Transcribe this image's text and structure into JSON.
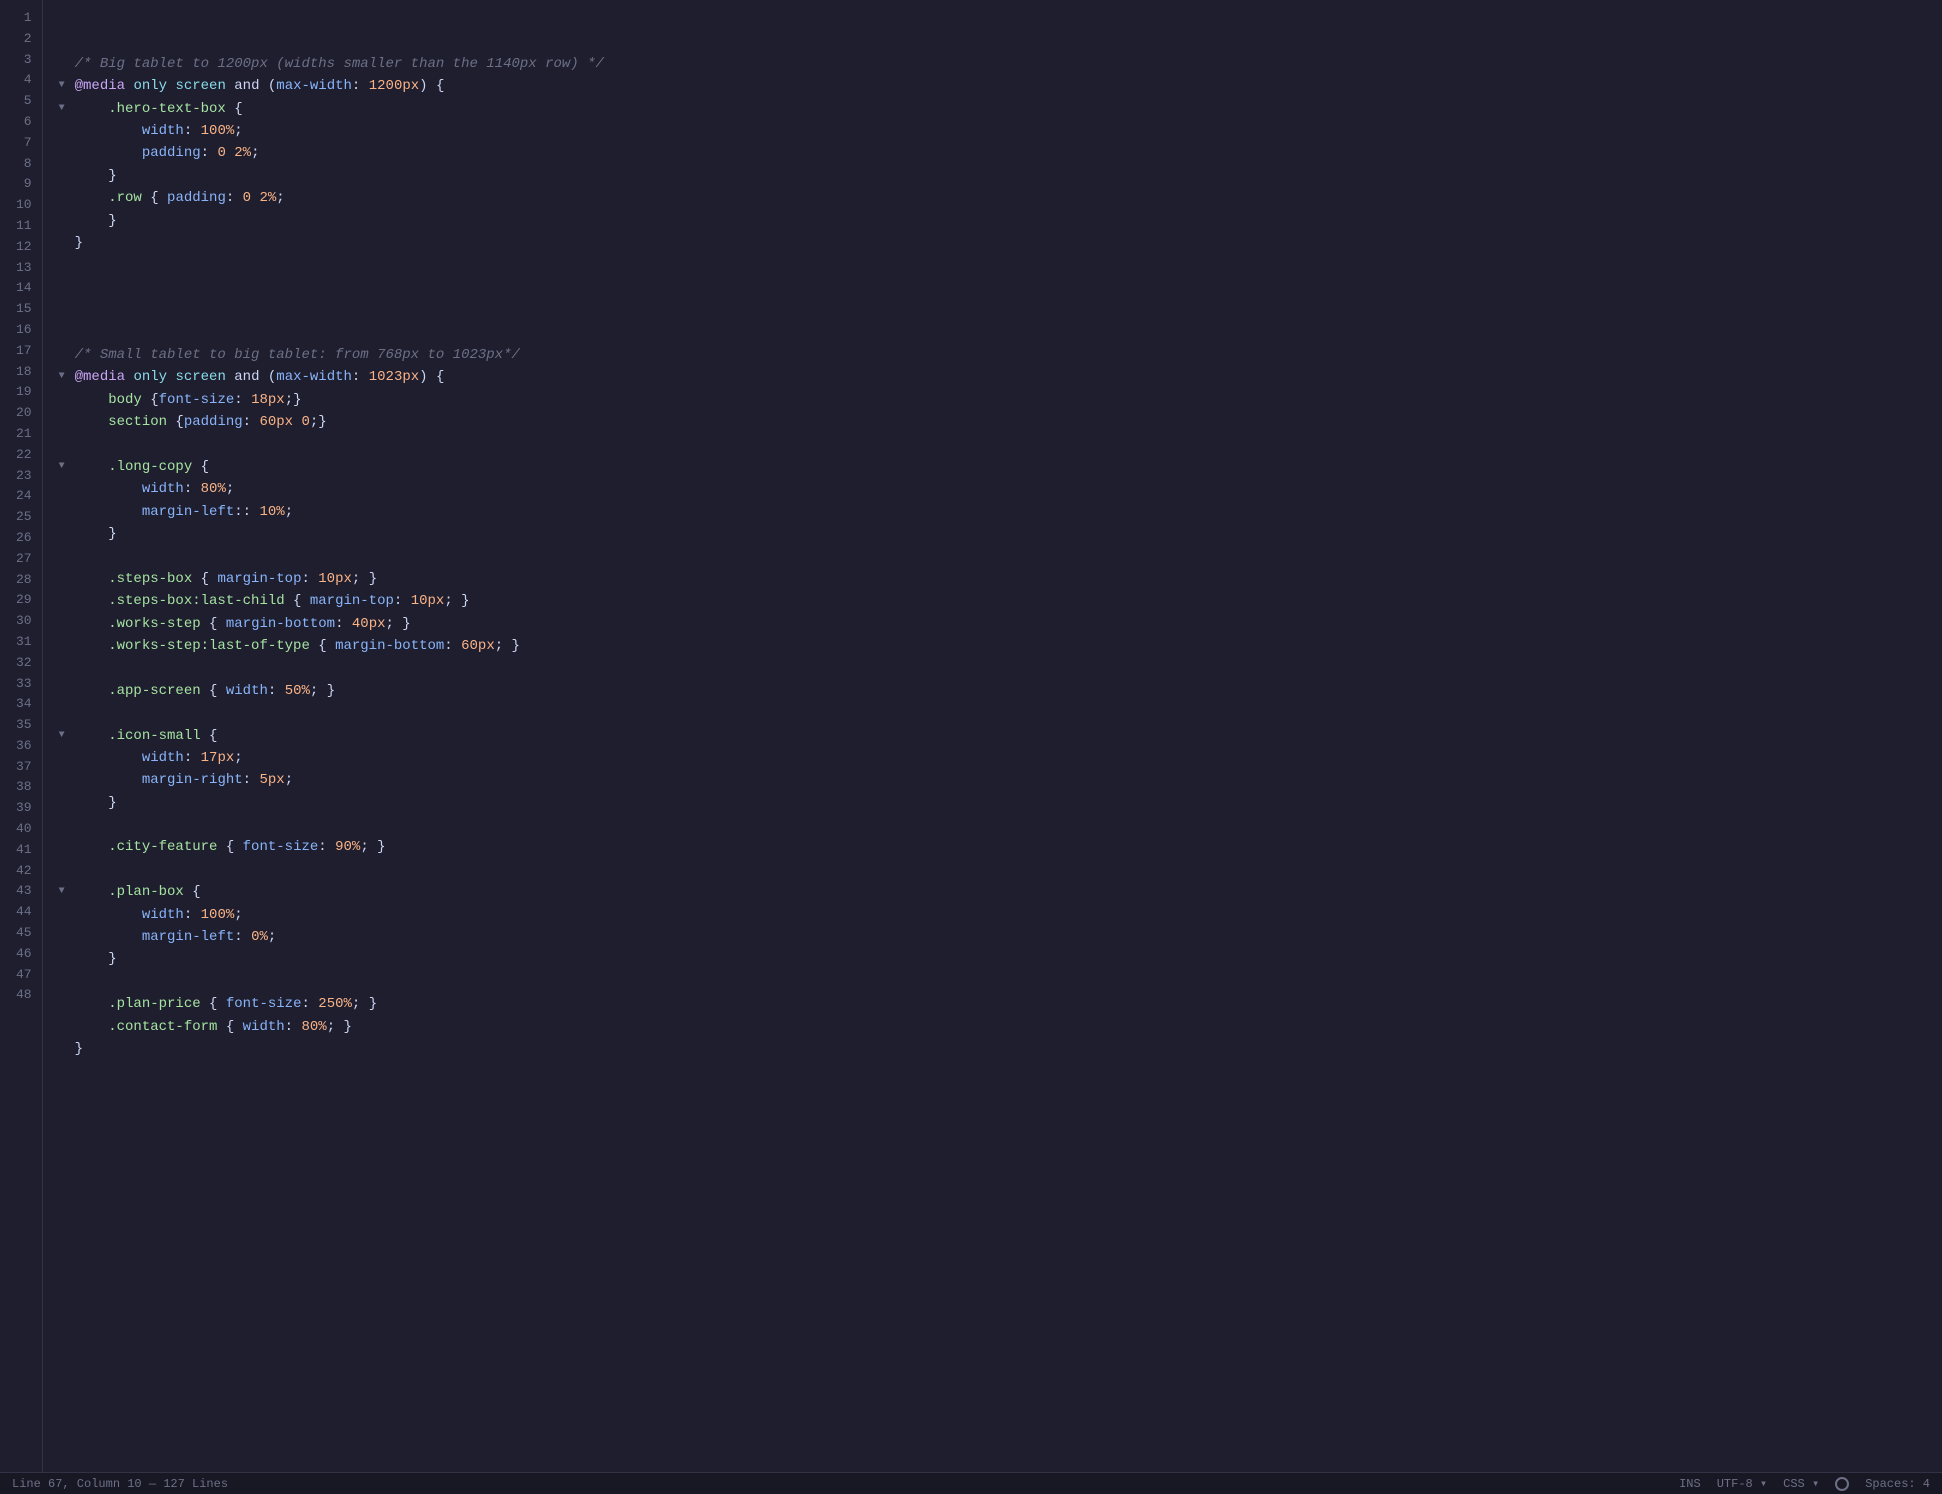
{
  "editor": {
    "lines": [
      {
        "num": 1,
        "fold": null,
        "tokens": [
          {
            "t": "comment",
            "v": "/* Big tablet to 1200px (widths smaller than the 1140px row) */"
          }
        ]
      },
      {
        "num": 2,
        "fold": "open",
        "tokens": [
          {
            "t": "at",
            "v": "@media"
          },
          {
            "t": "plain",
            "v": " "
          },
          {
            "t": "keyword",
            "v": "only screen"
          },
          {
            "t": "plain",
            "v": " "
          },
          {
            "t": "plain",
            "v": "and"
          },
          {
            "t": "plain",
            "v": " ("
          },
          {
            "t": "prop",
            "v": "max-width"
          },
          {
            "t": "plain",
            "v": ": "
          },
          {
            "t": "pvalue",
            "v": "1200px"
          },
          {
            "t": "plain",
            "v": ") {"
          }
        ]
      },
      {
        "num": 3,
        "fold": "open",
        "tokens": [
          {
            "t": "indent4",
            "v": "    "
          },
          {
            "t": "selector",
            "v": ".hero-text-box"
          },
          {
            "t": "plain",
            "v": " {"
          }
        ]
      },
      {
        "num": 4,
        "fold": null,
        "tokens": [
          {
            "t": "indent8",
            "v": "        "
          },
          {
            "t": "property",
            "v": "width"
          },
          {
            "t": "plain",
            "v": ": "
          },
          {
            "t": "pvalue",
            "v": "100%"
          },
          {
            "t": "plain",
            "v": ";"
          }
        ]
      },
      {
        "num": 5,
        "fold": null,
        "tokens": [
          {
            "t": "indent8",
            "v": "        "
          },
          {
            "t": "property",
            "v": "padding"
          },
          {
            "t": "plain",
            "v": ": "
          },
          {
            "t": "pvalue",
            "v": "0 2%"
          },
          {
            "t": "plain",
            "v": ";"
          }
        ]
      },
      {
        "num": 6,
        "fold": null,
        "tokens": [
          {
            "t": "indent4",
            "v": "    "
          },
          {
            "t": "plain",
            "v": "}"
          }
        ]
      },
      {
        "num": 7,
        "fold": null,
        "tokens": [
          {
            "t": "indent4",
            "v": "    "
          },
          {
            "t": "selector",
            "v": ".row"
          },
          {
            "t": "plain",
            "v": " { "
          },
          {
            "t": "property",
            "v": "padding"
          },
          {
            "t": "plain",
            "v": ": "
          },
          {
            "t": "pvalue",
            "v": "0 2%"
          },
          {
            "t": "plain",
            "v": ";"
          }
        ]
      },
      {
        "num": 8,
        "fold": null,
        "tokens": [
          {
            "t": "indent4",
            "v": "    "
          },
          {
            "t": "plain",
            "v": "}"
          }
        ]
      },
      {
        "num": 9,
        "fold": null,
        "tokens": [
          {
            "t": "plain",
            "v": "}"
          }
        ]
      },
      {
        "num": 10,
        "fold": null,
        "tokens": []
      },
      {
        "num": 11,
        "fold": null,
        "tokens": []
      },
      {
        "num": 12,
        "fold": null,
        "tokens": []
      },
      {
        "num": 13,
        "fold": null,
        "tokens": []
      },
      {
        "num": 14,
        "fold": null,
        "tokens": [
          {
            "t": "comment",
            "v": "/* Small tablet to big tablet: from 768px to 1023px*/"
          }
        ]
      },
      {
        "num": 15,
        "fold": "open",
        "tokens": [
          {
            "t": "at",
            "v": "@media"
          },
          {
            "t": "plain",
            "v": " "
          },
          {
            "t": "keyword",
            "v": "only screen"
          },
          {
            "t": "plain",
            "v": " "
          },
          {
            "t": "plain",
            "v": "and"
          },
          {
            "t": "plain",
            "v": " ("
          },
          {
            "t": "prop",
            "v": "max-width"
          },
          {
            "t": "plain",
            "v": ": "
          },
          {
            "t": "pvalue",
            "v": "1023px"
          },
          {
            "t": "plain",
            "v": ") {"
          }
        ]
      },
      {
        "num": 16,
        "fold": null,
        "tokens": [
          {
            "t": "indent4",
            "v": "    "
          },
          {
            "t": "selector",
            "v": "body"
          },
          {
            "t": "plain",
            "v": " {"
          },
          {
            "t": "property",
            "v": "font-size"
          },
          {
            "t": "plain",
            "v": ": "
          },
          {
            "t": "pvalue",
            "v": "18px"
          },
          {
            "t": "plain",
            "v": ";}"
          }
        ]
      },
      {
        "num": 17,
        "fold": null,
        "tokens": [
          {
            "t": "indent4",
            "v": "    "
          },
          {
            "t": "selector",
            "v": "section"
          },
          {
            "t": "plain",
            "v": " {"
          },
          {
            "t": "property",
            "v": "padding"
          },
          {
            "t": "plain",
            "v": ": "
          },
          {
            "t": "pvalue",
            "v": "60px 0"
          },
          {
            "t": "plain",
            "v": ";}"
          }
        ]
      },
      {
        "num": 18,
        "fold": null,
        "tokens": []
      },
      {
        "num": 19,
        "fold": "open",
        "tokens": [
          {
            "t": "indent4",
            "v": "    "
          },
          {
            "t": "selector",
            "v": ".long-copy"
          },
          {
            "t": "plain",
            "v": " {"
          }
        ]
      },
      {
        "num": 20,
        "fold": null,
        "tokens": [
          {
            "t": "indent8",
            "v": "        "
          },
          {
            "t": "property",
            "v": "width"
          },
          {
            "t": "plain",
            "v": ": "
          },
          {
            "t": "pvalue",
            "v": "80%"
          },
          {
            "t": "plain",
            "v": ";"
          }
        ]
      },
      {
        "num": 21,
        "fold": null,
        "tokens": [
          {
            "t": "indent8",
            "v": "        "
          },
          {
            "t": "property",
            "v": "margin-left"
          },
          {
            "t": "plain",
            "v": ":: "
          },
          {
            "t": "pvalue",
            "v": "10%"
          },
          {
            "t": "plain",
            "v": ";"
          }
        ]
      },
      {
        "num": 22,
        "fold": null,
        "tokens": [
          {
            "t": "indent4",
            "v": "    "
          },
          {
            "t": "plain",
            "v": "}"
          }
        ]
      },
      {
        "num": 23,
        "fold": null,
        "tokens": []
      },
      {
        "num": 24,
        "fold": null,
        "tokens": [
          {
            "t": "indent4",
            "v": "    "
          },
          {
            "t": "selector",
            "v": ".steps-box"
          },
          {
            "t": "plain",
            "v": " { "
          },
          {
            "t": "property",
            "v": "margin-top"
          },
          {
            "t": "plain",
            "v": ": "
          },
          {
            "t": "pvalue",
            "v": "10px"
          },
          {
            "t": "plain",
            "v": "; }"
          }
        ]
      },
      {
        "num": 25,
        "fold": null,
        "tokens": [
          {
            "t": "indent4",
            "v": "    "
          },
          {
            "t": "selector",
            "v": ".steps-box:last-child"
          },
          {
            "t": "plain",
            "v": " { "
          },
          {
            "t": "property",
            "v": "margin-top"
          },
          {
            "t": "plain",
            "v": ": "
          },
          {
            "t": "pvalue",
            "v": "10px"
          },
          {
            "t": "plain",
            "v": "; }"
          }
        ]
      },
      {
        "num": 26,
        "fold": null,
        "tokens": [
          {
            "t": "indent4",
            "v": "    "
          },
          {
            "t": "selector",
            "v": ".works-step"
          },
          {
            "t": "plain",
            "v": " { "
          },
          {
            "t": "property",
            "v": "margin-bottom"
          },
          {
            "t": "plain",
            "v": ": "
          },
          {
            "t": "pvalue",
            "v": "40px"
          },
          {
            "t": "plain",
            "v": "; }"
          }
        ]
      },
      {
        "num": 27,
        "fold": null,
        "tokens": [
          {
            "t": "indent4",
            "v": "    "
          },
          {
            "t": "selector",
            "v": ".works-step:last-of-type"
          },
          {
            "t": "plain",
            "v": " { "
          },
          {
            "t": "property",
            "v": "margin-bottom"
          },
          {
            "t": "plain",
            "v": ": "
          },
          {
            "t": "pvalue",
            "v": "60px"
          },
          {
            "t": "plain",
            "v": "; }"
          }
        ]
      },
      {
        "num": 28,
        "fold": null,
        "tokens": []
      },
      {
        "num": 29,
        "fold": null,
        "tokens": [
          {
            "t": "indent4",
            "v": "    "
          },
          {
            "t": "selector",
            "v": ".app-screen"
          },
          {
            "t": "plain",
            "v": " { "
          },
          {
            "t": "property",
            "v": "width"
          },
          {
            "t": "plain",
            "v": ": "
          },
          {
            "t": "pvalue",
            "v": "50%"
          },
          {
            "t": "plain",
            "v": "; }"
          }
        ]
      },
      {
        "num": 30,
        "fold": null,
        "tokens": []
      },
      {
        "num": 31,
        "fold": "open",
        "tokens": [
          {
            "t": "indent4",
            "v": "    "
          },
          {
            "t": "selector",
            "v": ".icon-small"
          },
          {
            "t": "plain",
            "v": " {"
          }
        ]
      },
      {
        "num": 32,
        "fold": null,
        "tokens": [
          {
            "t": "indent8",
            "v": "        "
          },
          {
            "t": "property",
            "v": "width"
          },
          {
            "t": "plain",
            "v": ": "
          },
          {
            "t": "pvalue",
            "v": "17px"
          },
          {
            "t": "plain",
            "v": ";"
          }
        ]
      },
      {
        "num": 33,
        "fold": null,
        "tokens": [
          {
            "t": "indent8",
            "v": "        "
          },
          {
            "t": "property",
            "v": "margin-right"
          },
          {
            "t": "plain",
            "v": ": "
          },
          {
            "t": "pvalue",
            "v": "5px"
          },
          {
            "t": "plain",
            "v": ";"
          }
        ]
      },
      {
        "num": 34,
        "fold": null,
        "tokens": [
          {
            "t": "indent4",
            "v": "    "
          },
          {
            "t": "plain",
            "v": "}"
          }
        ]
      },
      {
        "num": 35,
        "fold": null,
        "tokens": []
      },
      {
        "num": 36,
        "fold": null,
        "tokens": [
          {
            "t": "indent4",
            "v": "    "
          },
          {
            "t": "selector",
            "v": ".city-feature"
          },
          {
            "t": "plain",
            "v": " { "
          },
          {
            "t": "property",
            "v": "font-size"
          },
          {
            "t": "plain",
            "v": ": "
          },
          {
            "t": "pvalue",
            "v": "90%"
          },
          {
            "t": "plain",
            "v": "; }"
          }
        ]
      },
      {
        "num": 37,
        "fold": null,
        "tokens": []
      },
      {
        "num": 38,
        "fold": "open",
        "tokens": [
          {
            "t": "indent4",
            "v": "    "
          },
          {
            "t": "selector",
            "v": ".plan-box"
          },
          {
            "t": "plain",
            "v": " {"
          }
        ]
      },
      {
        "num": 39,
        "fold": null,
        "tokens": [
          {
            "t": "indent8",
            "v": "        "
          },
          {
            "t": "property",
            "v": "width"
          },
          {
            "t": "plain",
            "v": ": "
          },
          {
            "t": "pvalue",
            "v": "100%"
          },
          {
            "t": "plain",
            "v": ";"
          }
        ]
      },
      {
        "num": 40,
        "fold": null,
        "tokens": [
          {
            "t": "indent8",
            "v": "        "
          },
          {
            "t": "property",
            "v": "margin-left"
          },
          {
            "t": "plain",
            "v": ": "
          },
          {
            "t": "pvalue",
            "v": "0%"
          },
          {
            "t": "plain",
            "v": ";"
          }
        ]
      },
      {
        "num": 41,
        "fold": null,
        "tokens": [
          {
            "t": "indent4",
            "v": "    "
          },
          {
            "t": "plain",
            "v": "}"
          }
        ]
      },
      {
        "num": 42,
        "fold": null,
        "tokens": []
      },
      {
        "num": 43,
        "fold": null,
        "tokens": [
          {
            "t": "indent4",
            "v": "    "
          },
          {
            "t": "selector",
            "v": ".plan-price"
          },
          {
            "t": "plain",
            "v": " { "
          },
          {
            "t": "property",
            "v": "font-size"
          },
          {
            "t": "plain",
            "v": ": "
          },
          {
            "t": "pvalue",
            "v": "250%"
          },
          {
            "t": "plain",
            "v": "; }"
          }
        ]
      },
      {
        "num": 44,
        "fold": null,
        "tokens": [
          {
            "t": "indent4",
            "v": "    "
          },
          {
            "t": "selector",
            "v": ".contact-form"
          },
          {
            "t": "plain",
            "v": " { "
          },
          {
            "t": "property",
            "v": "width"
          },
          {
            "t": "plain",
            "v": ": "
          },
          {
            "t": "pvalue",
            "v": "80%"
          },
          {
            "t": "plain",
            "v": "; }"
          }
        ]
      },
      {
        "num": 45,
        "fold": null,
        "tokens": [
          {
            "t": "plain",
            "v": "}"
          }
        ]
      },
      {
        "num": 46,
        "fold": null,
        "tokens": []
      },
      {
        "num": 47,
        "fold": null,
        "tokens": []
      },
      {
        "num": 48,
        "fold": null,
        "tokens": []
      }
    ]
  },
  "statusBar": {
    "position": "Line 67, Column 10",
    "lines": "127 Lines",
    "mode": "INS",
    "encoding": "UTF-8",
    "language": "CSS",
    "indent": "Spaces: 4"
  }
}
